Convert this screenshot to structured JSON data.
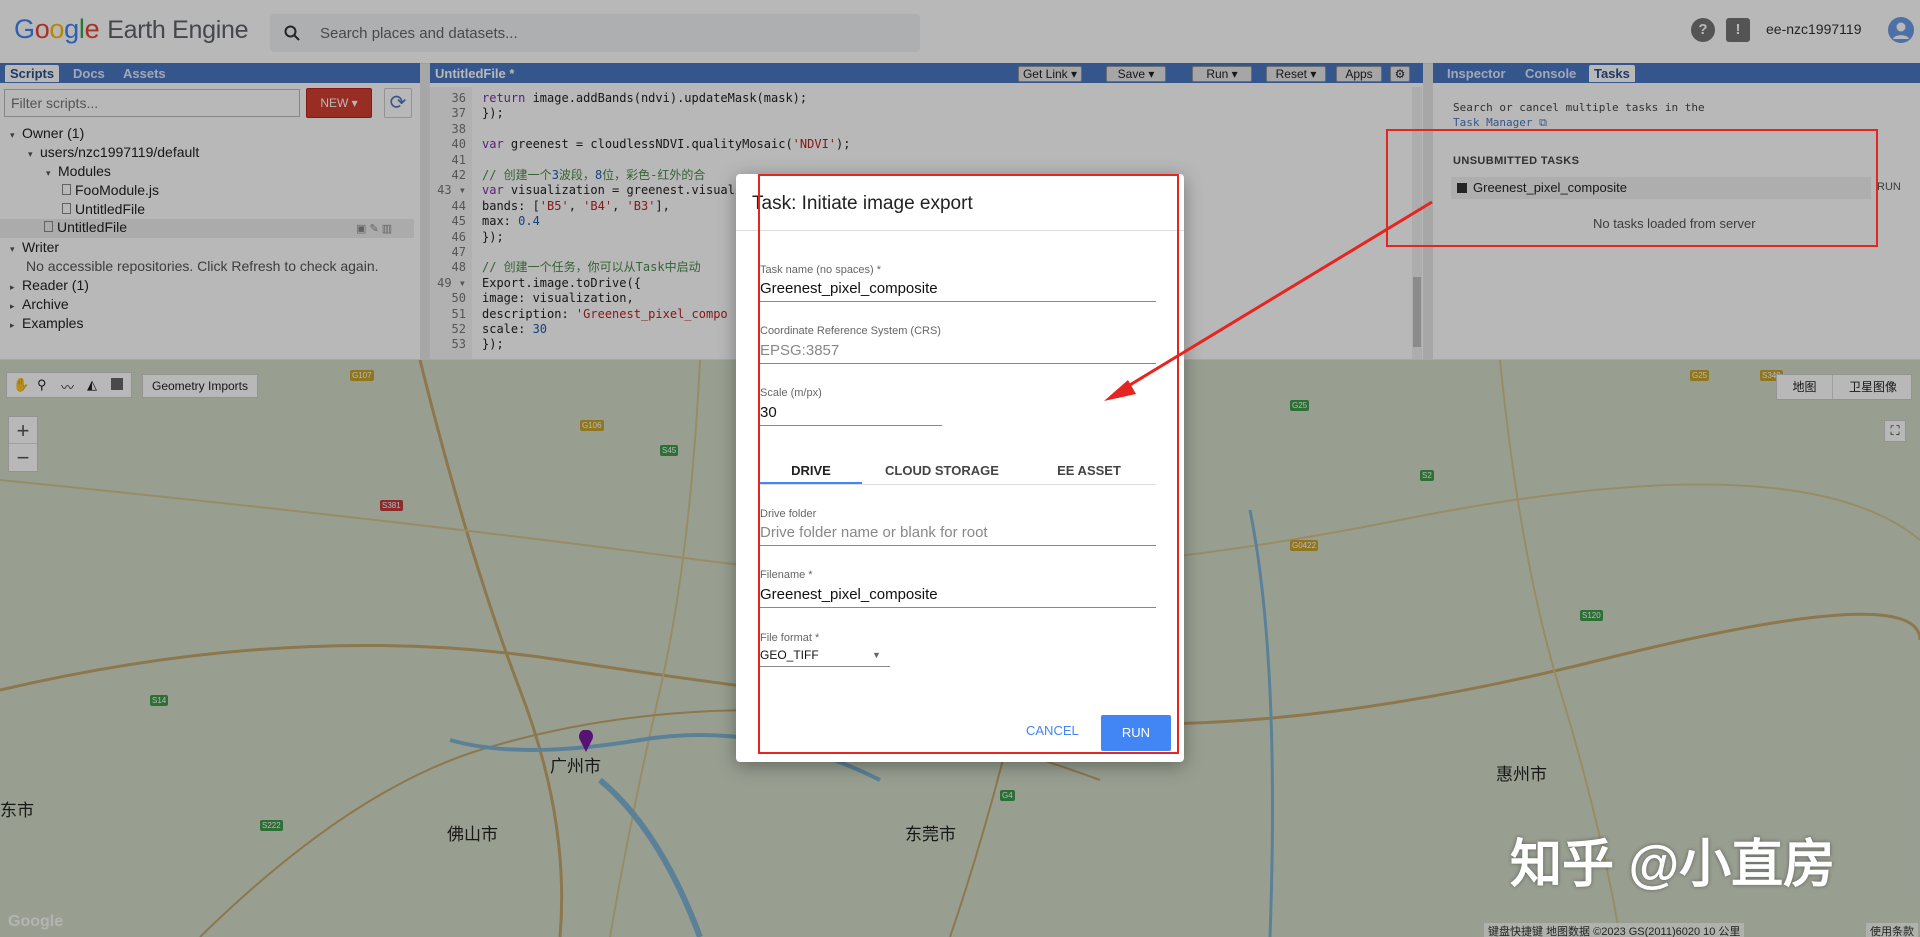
{
  "app": {
    "logo_g1": "G",
    "logo_o1": "o",
    "logo_o2": "o",
    "logo_g2": "g",
    "logo_l": "l",
    "logo_e": "e",
    "logo_rest": "Earth Engine",
    "search_placeholder": "Search places and datasets...",
    "help_icon": "?",
    "feedback_icon": "!",
    "user": "ee-nzc1997119"
  },
  "left_panel": {
    "tabs": [
      "Scripts",
      "Docs",
      "Assets"
    ],
    "filter_placeholder": "Filter scripts...",
    "new_button": "NEW",
    "tree": [
      {
        "label": "Owner (1)",
        "indent": 0,
        "tri": "▾"
      },
      {
        "label": "users/nzc1997119/default",
        "indent": 1,
        "tri": "▾"
      },
      {
        "label": "Modules",
        "indent": 2,
        "tri": "▾"
      },
      {
        "label": "FooModule.js",
        "indent": 3,
        "tri": ""
      },
      {
        "label": "UntitledFile",
        "indent": 3,
        "tri": ""
      },
      {
        "label": "UntitledFile",
        "indent": 2,
        "tri": ""
      },
      {
        "label": "Writer",
        "indent": 0,
        "tri": "▾"
      },
      {
        "label": "No accessible repositories. Click Refresh to check again.",
        "indent": 1,
        "tri": ""
      },
      {
        "label": "Reader (1)",
        "indent": 0,
        "tri": "▸"
      },
      {
        "label": "Archive",
        "indent": 0,
        "tri": "▸"
      },
      {
        "label": "Examples",
        "indent": 0,
        "tri": "▸"
      }
    ]
  },
  "editor": {
    "title": "UntitledFile *",
    "buttons": {
      "get_link": "Get Link",
      "save": "Save",
      "run": "Run",
      "reset": "Reset",
      "apps": "Apps"
    },
    "lines": [
      {
        "n": "36",
        "t": "  return image.addBands(ndvi).updateMask(mask);"
      },
      {
        "n": "37",
        "t": "});"
      },
      {
        "n": "38",
        "t": ""
      },
      {
        "n": "40",
        "t": "var greenest = cloudlessNDVI.qualityMosaic('NDVI');"
      },
      {
        "n": "41",
        "t": ""
      },
      {
        "n": "42",
        "t": "// 创建一个3波段，8位，彩色-红外的合"
      },
      {
        "n": "43 ▾",
        "t": "var visualization = greenest.visuali"
      },
      {
        "n": "44",
        "t": "  bands: ['B5', 'B4', 'B3'],"
      },
      {
        "n": "45",
        "t": "  max: 0.4"
      },
      {
        "n": "46",
        "t": "});"
      },
      {
        "n": "47",
        "t": ""
      },
      {
        "n": "48",
        "t": "// 创建一个任务，你可以从Task中启动"
      },
      {
        "n": "49 ▾",
        "t": "Export.image.toDrive({"
      },
      {
        "n": "50",
        "t": "  image: visualization,"
      },
      {
        "n": "51",
        "t": "  description: 'Greenest_pixel_compo"
      },
      {
        "n": "52",
        "t": "  scale: 30"
      },
      {
        "n": "53",
        "t": "});"
      }
    ]
  },
  "right_panel": {
    "tabs": [
      "Inspector",
      "Console",
      "Tasks"
    ],
    "intro": "Search or cancel multiple tasks in the",
    "task_manager_link": "Task Manager",
    "unsubmitted_heading": "UNSUBMITTED TASKS",
    "task_name": "Greenest_pixel_composite",
    "task_run": "RUN",
    "no_tasks": "No tasks loaded from server"
  },
  "map": {
    "geometry_imports": "Geometry Imports",
    "zoom_in": "+",
    "zoom_out": "−",
    "map_type_map": "地图",
    "map_type_satellite": "卫星图像",
    "cities": [
      {
        "name": "广州市"
      },
      {
        "name": "佛山市"
      },
      {
        "name": "东莞市"
      },
      {
        "name": "惠州市"
      },
      {
        "name": "东市"
      }
    ],
    "attribution": "键盘快捷键   地图数据 ©2023 GS(2011)6020   10 公里",
    "terms": "使用条款",
    "google": "Google",
    "watermark": "知乎 @小直房"
  },
  "dialog": {
    "title": "Task: Initiate image export",
    "task_name_label": "Task name (no spaces) *",
    "task_name_value": "Greenest_pixel_composite",
    "crs_label": "Coordinate Reference System (CRS)",
    "crs_value": "EPSG:3857",
    "scale_label": "Scale (m/px)",
    "scale_value": "30",
    "tabs": [
      "DRIVE",
      "CLOUD STORAGE",
      "EE ASSET"
    ],
    "drive_folder_label": "Drive folder",
    "drive_folder_placeholder": "Drive folder name or blank for root",
    "filename_label": "Filename *",
    "filename_value": "Greenest_pixel_composite",
    "format_label": "File format *",
    "format_value": "GEO_TIFF",
    "cancel": "CANCEL",
    "run": "RUN"
  },
  "colors": {
    "accent": "#4285f4",
    "header_blue": "#4a78c2",
    "annotation_red": "#e52520",
    "new_button": "#d23f31"
  }
}
